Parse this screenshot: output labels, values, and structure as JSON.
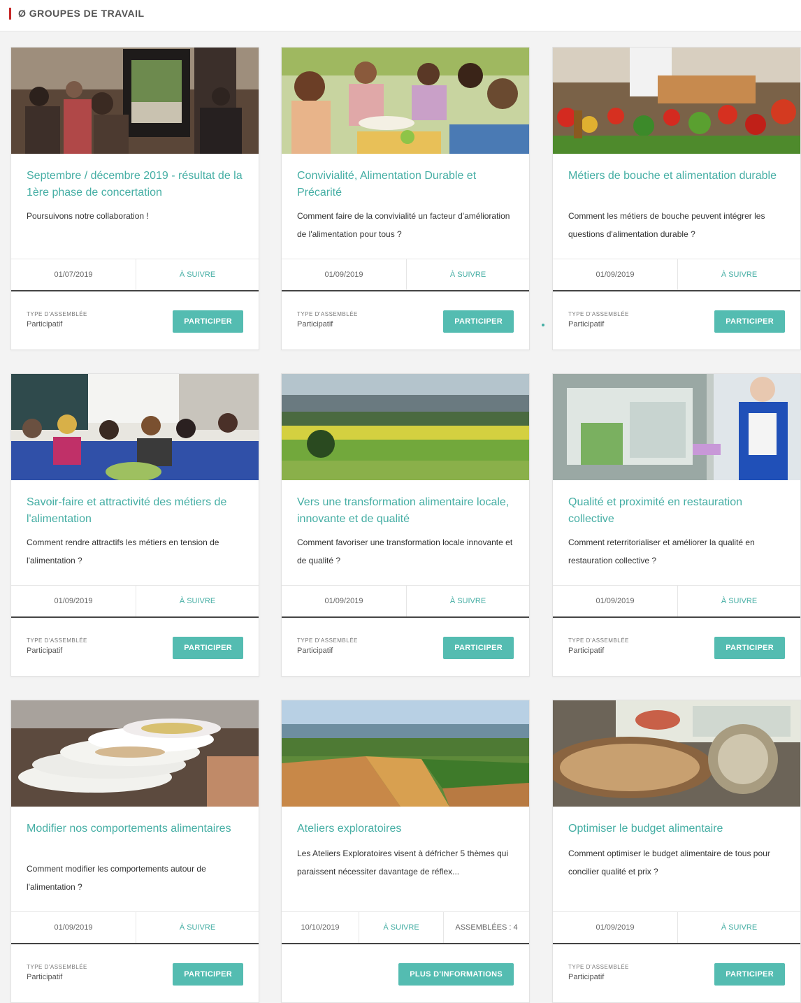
{
  "section": {
    "title": "ø GROUPES DE TRAVAIL"
  },
  "colors": {
    "accent": "#45aea4",
    "button": "#54bcb1",
    "marker": "#c62828"
  },
  "cards": [
    {
      "title": "Septembre / décembre 2019 - résultat de la 1ère phase de concertation",
      "description": "Poursuivons notre collaboration !",
      "date": "01/07/2019",
      "follow": "À SUIVRE",
      "type_label": "TYPE D'ASSEMBLÉE",
      "type_value": "Participatif",
      "button": "PARTICIPER"
    },
    {
      "title": "Convivialité, Alimentation Durable et Précarité",
      "description": "Comment faire de la convivialité un facteur d'amélioration de l'alimentation pour tous ?",
      "date": "01/09/2019",
      "follow": "À SUIVRE",
      "type_label": "TYPE D'ASSEMBLÉE",
      "type_value": "Participatif",
      "button": "PARTICIPER"
    },
    {
      "title": "Métiers de bouche et alimentation durable",
      "description": "Comment les métiers de bouche peuvent intégrer les questions d'alimentation durable ?",
      "date": "01/09/2019",
      "follow": "À SUIVRE",
      "type_label": "TYPE D'ASSEMBLÉE",
      "type_value": "Participatif",
      "button": "PARTICIPER"
    },
    {
      "title": "Savoir-faire et attractivité des métiers de l'alimentation",
      "description": "Comment rendre attractifs les métiers en tension de l'alimentation ?",
      "date": "01/09/2019",
      "follow": "À SUIVRE",
      "type_label": "TYPE D'ASSEMBLÉE",
      "type_value": "Participatif",
      "button": "PARTICIPER"
    },
    {
      "title": "Vers une transformation alimentaire locale, innovante et de qualité",
      "description": "Comment favoriser une transformation locale innovante et de qualité ?",
      "date": "01/09/2019",
      "follow": "À SUIVRE",
      "type_label": "TYPE D'ASSEMBLÉE",
      "type_value": "Participatif",
      "button": "PARTICIPER"
    },
    {
      "title": "Qualité et proximité en restauration collective",
      "description": "Comment reterritorialiser et améliorer la qualité en restauration collective ?",
      "date": "01/09/2019",
      "follow": "À SUIVRE",
      "type_label": "TYPE D'ASSEMBLÉE",
      "type_value": "Participatif",
      "button": "PARTICIPER"
    },
    {
      "title": "Modifier nos comportements alimentaires",
      "description": "Comment modifier les comportements autour de l'alimentation ?",
      "date": "01/09/2019",
      "follow": "À SUIVRE",
      "type_label": "TYPE D'ASSEMBLÉE",
      "type_value": "Participatif",
      "button": "PARTICIPER"
    },
    {
      "title": "Ateliers exploratoires",
      "description": "Les Ateliers Exploratoires visent à défricher 5 thèmes qui paraissent nécessiter davantage de réflex...",
      "date": "10/10/2019",
      "follow": "À SUIVRE",
      "count": "ASSEMBLÉES : 4",
      "button": "PLUS D'INFORMATIONS"
    },
    {
      "title": "Optimiser le budget alimentaire",
      "description": "Comment optimiser le budget alimentaire de tous pour concilier qualité et prix ?",
      "date": "01/09/2019",
      "follow": "À SUIVRE",
      "type_label": "TYPE D'ASSEMBLÉE",
      "type_value": "Participatif",
      "button": "PARTICIPER"
    }
  ]
}
